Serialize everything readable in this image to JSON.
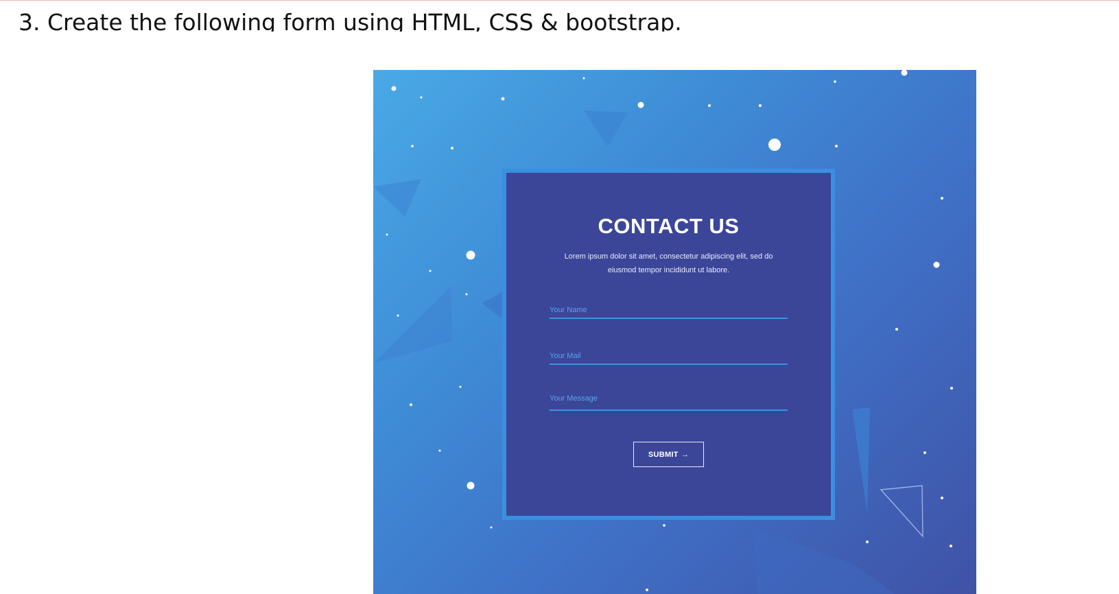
{
  "question": {
    "text": "3. Create the following form using HTML, CSS & bootstrap."
  },
  "contact_form": {
    "title": "CONTACT US",
    "description": "Lorem ipsum dolor sit amet, consectetur adipiscing elit, sed do eiusmod tempor incididunt ut labore.",
    "name_field": {
      "placeholder": "Your Name",
      "value": ""
    },
    "mail_field": {
      "placeholder": "Your Mail",
      "value": ""
    },
    "message_field": {
      "placeholder": "Your Message",
      "value": ""
    },
    "submit_label": "SUBMIT",
    "submit_icon": "arrow-right-icon",
    "submit_glyph": "→"
  },
  "colors": {
    "card_background": "#3c4698",
    "card_border": "#3a8fe0",
    "field_underline": "#3b93e4",
    "placeholder": "#55a4ee",
    "background_gradient_start": "#4aa9e6",
    "background_gradient_end": "#3f52a6"
  }
}
